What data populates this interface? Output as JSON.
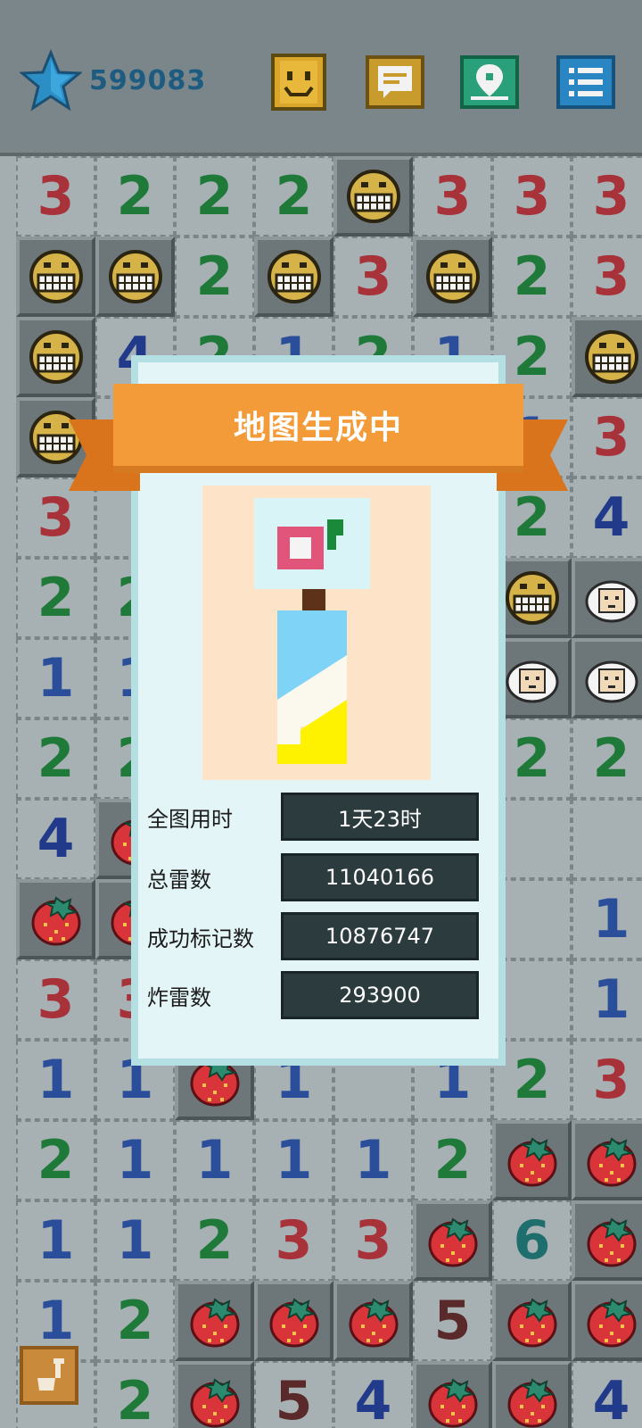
{
  "header": {
    "score": "599083",
    "icons": [
      "star-icon",
      "smiley-icon",
      "chat-icon",
      "map-pin-icon",
      "menu-list-icon"
    ]
  },
  "dialog": {
    "title": "地图生成中",
    "stats": {
      "time_label": "全图用时",
      "time_value": "1天23时",
      "total_label": "总雷数",
      "total_value": "11040166",
      "flagged_label": "成功标记数",
      "flagged_value": "10876747",
      "exploded_label": "炸雷数",
      "exploded_value": "293900"
    }
  },
  "board": {
    "rows": [
      [
        "3",
        "2",
        "2",
        "2",
        "grin",
        "3",
        "3",
        "3"
      ],
      [
        "grin",
        "grin",
        "2",
        "grin",
        "3",
        "grin",
        "2",
        "3"
      ],
      [
        "grin",
        "4",
        "2",
        "1",
        "2",
        "1",
        "2",
        "grin"
      ],
      [
        "grin",
        "",
        "",
        "",
        "",
        "",
        "1",
        "3"
      ],
      [
        "3",
        "",
        "",
        "",
        "",
        "",
        "2",
        "4"
      ],
      [
        "2",
        "2",
        "",
        "",
        "",
        "",
        "grin",
        "sheep"
      ],
      [
        "1",
        "1",
        "",
        "",
        "",
        "",
        "sheep",
        "sheep"
      ],
      [
        "2",
        "2",
        "",
        "",
        "",
        "",
        "2",
        "2"
      ],
      [
        "4",
        "berry",
        "",
        "",
        "",
        "",
        "",
        ""
      ],
      [
        "berry",
        "berry",
        "",
        "",
        "",
        "",
        "",
        "1"
      ],
      [
        "3",
        "3",
        "",
        "",
        "",
        "",
        "",
        "1"
      ],
      [
        "1",
        "1",
        "berry",
        "1",
        "",
        "1",
        "2",
        "3"
      ],
      [
        "2",
        "1",
        "1",
        "1",
        "1",
        "2",
        "berry",
        "berry"
      ],
      [
        "1",
        "1",
        "2",
        "3",
        "3",
        "berry",
        "6",
        "berry"
      ],
      [
        "1",
        "2",
        "berry",
        "berry",
        "berry",
        "5",
        "berry",
        "berry"
      ],
      [
        "",
        "2",
        "berry",
        "5",
        "4",
        "berry",
        "berry",
        "4"
      ]
    ]
  },
  "colors": {
    "ribbon": "#f49b39",
    "dialog_bg": "#e3f5f6",
    "score": "#1d5c80"
  }
}
